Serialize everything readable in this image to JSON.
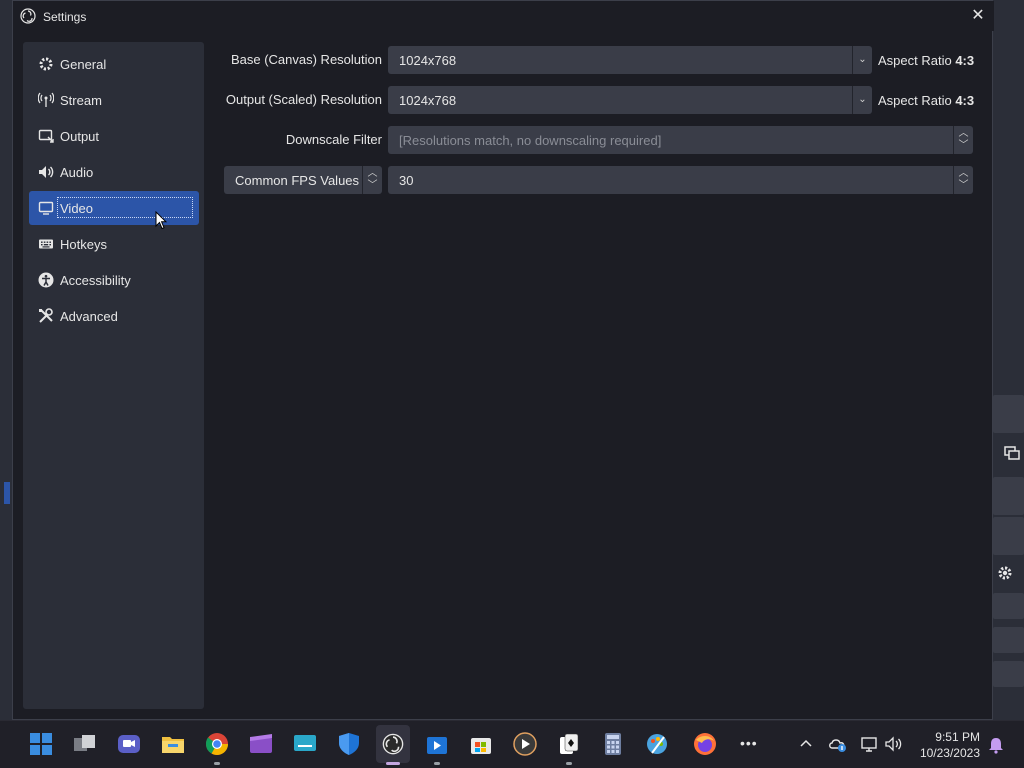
{
  "window": {
    "title": "Settings",
    "close_icon": "close-icon"
  },
  "sidebar": {
    "items": [
      {
        "label": "General",
        "icon": "gear-icon"
      },
      {
        "label": "Stream",
        "icon": "antenna-icon"
      },
      {
        "label": "Output",
        "icon": "output-icon"
      },
      {
        "label": "Audio",
        "icon": "speaker-icon"
      },
      {
        "label": "Video",
        "icon": "monitor-icon",
        "active": true
      },
      {
        "label": "Hotkeys",
        "icon": "keyboard-icon"
      },
      {
        "label": "Accessibility",
        "icon": "accessibility-icon"
      },
      {
        "label": "Advanced",
        "icon": "tools-icon"
      }
    ]
  },
  "video": {
    "base_label": "Base (Canvas) Resolution",
    "base_value": "1024x768",
    "base_aspect_prefix": "Aspect Ratio",
    "base_aspect_value": "4:3",
    "output_label": "Output (Scaled) Resolution",
    "output_value": "1024x768",
    "output_aspect_prefix": "Aspect Ratio",
    "output_aspect_value": "4:3",
    "downscale_label": "Downscale Filter",
    "downscale_value": "[Resolutions match, no downscaling required]",
    "fps_type": "Common FPS Values",
    "fps_value": "30"
  },
  "taskbar": {
    "time": "9:51 PM",
    "date": "10/23/2023",
    "more_label": "•••",
    "chevron_label": "^"
  },
  "colors": {
    "accent": "#2c55a8",
    "panel": "#2b2e38",
    "input": "#3a3d48",
    "window": "#1c1d24"
  }
}
